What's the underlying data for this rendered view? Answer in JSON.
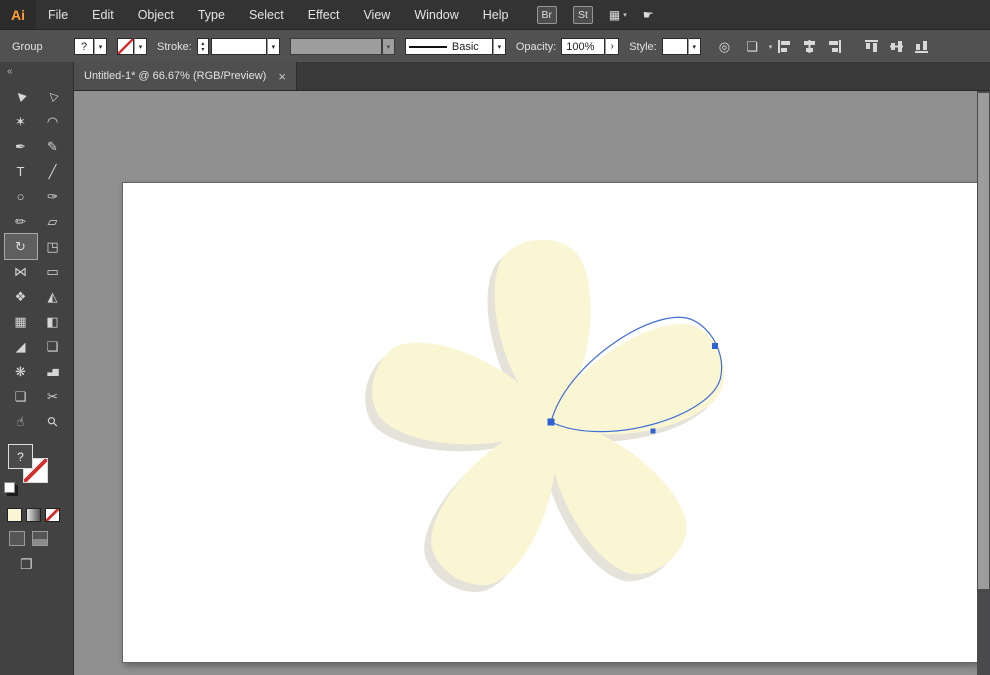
{
  "menubar": {
    "logo": "Ai",
    "menus": [
      "File",
      "Edit",
      "Object",
      "Type",
      "Select",
      "Effect",
      "View",
      "Window",
      "Help"
    ],
    "br_button": "Br",
    "st_button": "St"
  },
  "control_bar": {
    "context_label": "Group",
    "profile_value": "?",
    "stroke_label": "Stroke:",
    "line_style_value": "Basic",
    "opacity_label": "Opacity:",
    "opacity_value": "100%",
    "style_label": "Style:"
  },
  "tab": {
    "title": "Untitled-1* @ 66.67% (RGB/Preview)",
    "close": "×"
  },
  "toolbar": {
    "collapse": "«",
    "fill_query": "?",
    "tools": [
      {
        "name": "selection",
        "glyph": "▶"
      },
      {
        "name": "direct-selection",
        "glyph": "▷"
      },
      {
        "name": "magic-wand",
        "glyph": "✶"
      },
      {
        "name": "lasso",
        "glyph": "◠"
      },
      {
        "name": "pen",
        "glyph": "✒"
      },
      {
        "name": "curvature",
        "glyph": "✎"
      },
      {
        "name": "type",
        "glyph": "T"
      },
      {
        "name": "line-segment",
        "glyph": "╱"
      },
      {
        "name": "ellipse",
        "glyph": "○"
      },
      {
        "name": "paintbrush",
        "glyph": "✑"
      },
      {
        "name": "pencil",
        "glyph": "✏"
      },
      {
        "name": "eraser",
        "glyph": "▱"
      },
      {
        "name": "rotate",
        "glyph": "↻"
      },
      {
        "name": "scale",
        "glyph": "◳"
      },
      {
        "name": "width",
        "glyph": "⋈"
      },
      {
        "name": "free-transform",
        "glyph": "▭"
      },
      {
        "name": "shape-builder",
        "glyph": "❖"
      },
      {
        "name": "perspective-grid",
        "glyph": "◭"
      },
      {
        "name": "mesh",
        "glyph": "▦"
      },
      {
        "name": "gradient",
        "glyph": "◧"
      },
      {
        "name": "eyedropper",
        "glyph": "◢"
      },
      {
        "name": "blend",
        "glyph": "❑"
      },
      {
        "name": "symbol-sprayer",
        "glyph": "❋"
      },
      {
        "name": "column-graph",
        "glyph": "▃▆"
      },
      {
        "name": "artboard",
        "glyph": "❏"
      },
      {
        "name": "slice",
        "glyph": "✂"
      },
      {
        "name": "hand",
        "glyph": "☝"
      },
      {
        "name": "zoom",
        "glyph": "⚲"
      }
    ]
  },
  "icons": {
    "chevron": "▾",
    "stepper_up": "▴",
    "stepper_down": "▾",
    "more": "›",
    "arrange": "▦",
    "share": "☛",
    "globe": "◎",
    "doc_options": "❏",
    "screen_mode": "❐"
  },
  "canvas": {
    "flower": {
      "petal_fill": "#FAF6D3",
      "petal_shadow": "#E5E2DA",
      "selection_color": "#3E6FD6",
      "anchor_color": "#2E62D0"
    }
  }
}
